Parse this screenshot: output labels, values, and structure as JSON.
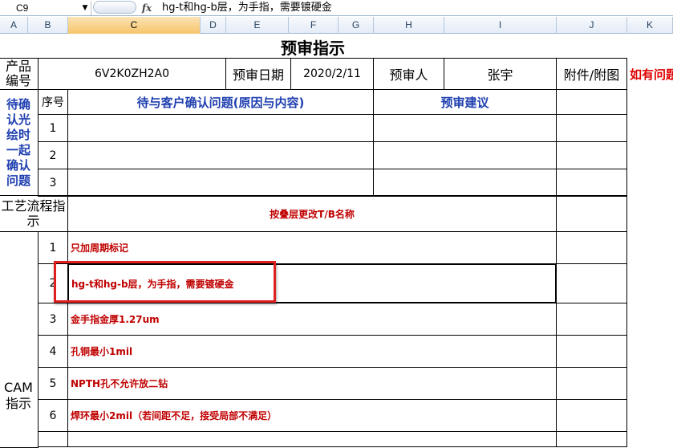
{
  "formula_bar": {
    "name_box": "C9",
    "fx": "fx",
    "content": "hg-t和hg-b层，为手指，需要镀硬金"
  },
  "columns": [
    "A",
    "B",
    "C",
    "D",
    "E",
    "F",
    "G",
    "H",
    "I",
    "J",
    "K"
  ],
  "selected_column": "C",
  "sheet": {
    "title": "预审指示",
    "product_label": "产品编号",
    "product_value": "6V2K0ZH2A0",
    "review_date_label": "预审日期",
    "review_date_value": "2020/2/11",
    "reviewer_label": "预审人",
    "reviewer_value": "张宇",
    "attachment_label": "附件/附图",
    "note_partial": "如有问题",
    "seq_label": "序号",
    "pending_header": "待与客户确认问题(原因与内容)",
    "suggest_header": "预审建议",
    "pending_side_label": "待确认光绘时一起确认问题",
    "pending_rows": [
      "1",
      "2",
      "3"
    ],
    "process_label": "工艺流程指示",
    "process_text": "按叠层更改T/B名称",
    "cam_label": "CAM指示",
    "cam_items": [
      {
        "num": "1",
        "text": "只加周期标记"
      },
      {
        "num": "2",
        "text": "hg-t和hg-b层，为手指，需要镀硬金"
      },
      {
        "num": "3",
        "text": "金手指金厚1.27um"
      },
      {
        "num": "4",
        "text": "孔铜最小1mil"
      },
      {
        "num": "5",
        "text": "NPTH孔不允许放二钻"
      },
      {
        "num": "6",
        "text": "焊环最小2mil（若间距不足，接受局部不满足）"
      }
    ]
  },
  "highlight_color": "#e02020"
}
